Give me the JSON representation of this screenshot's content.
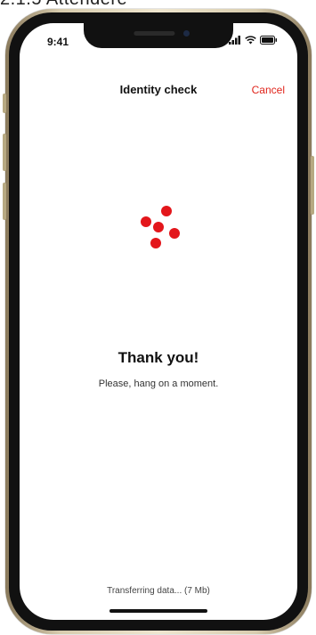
{
  "caption": "2.1.5 Attendere",
  "status_bar": {
    "time": "9:41"
  },
  "nav": {
    "title": "Identity check",
    "cancel_label": "Cancel"
  },
  "content": {
    "headline": "Thank you!",
    "subtext": "Please, hang on a moment."
  },
  "footer": {
    "status": "Transferring data... (7 Mb)"
  },
  "icons": {
    "spinner": "loading-dots-icon",
    "signal": "signal-icon",
    "wifi": "wifi-icon",
    "battery": "battery-icon"
  },
  "colors": {
    "accent": "#e3161b",
    "cancel": "#e0241b"
  }
}
